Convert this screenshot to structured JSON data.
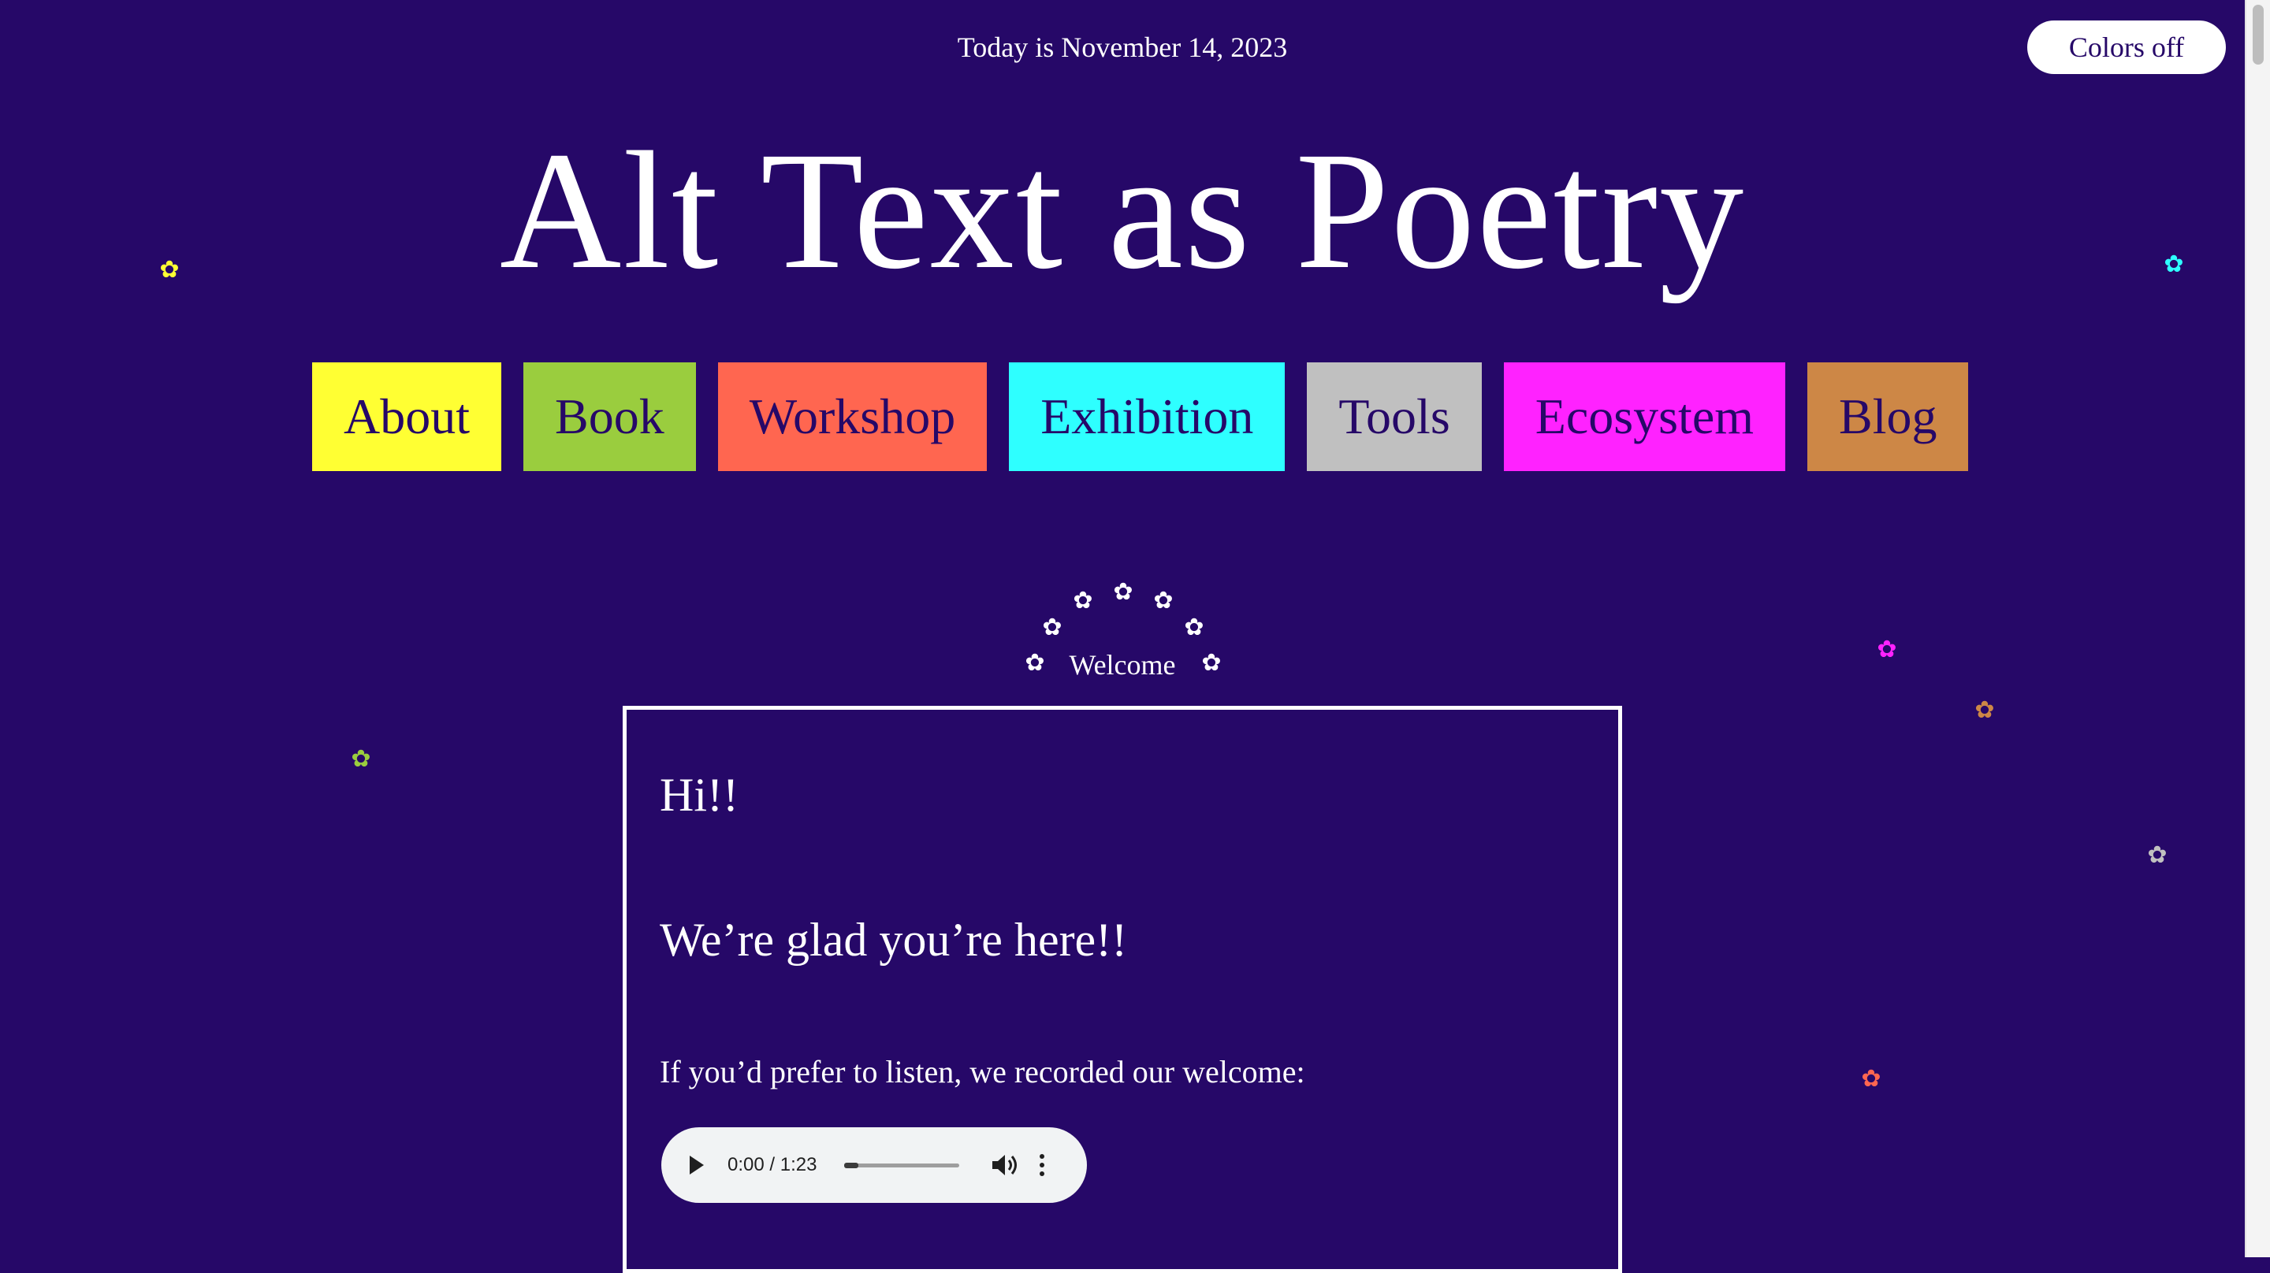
{
  "header": {
    "date_text": "Today is November 14, 2023",
    "colors_button_label": "Colors off"
  },
  "site_title": "Alt Text as Poetry",
  "nav": [
    {
      "label": "About",
      "color": "#ffff33"
    },
    {
      "label": "Book",
      "color": "#9acd3e"
    },
    {
      "label": "Workshop",
      "color": "#ff6650"
    },
    {
      "label": "Exhibition",
      "color": "#2effff"
    },
    {
      "label": "Tools",
      "color": "#c0c0c0"
    },
    {
      "label": "Ecosystem",
      "color": "#ff22ff"
    },
    {
      "label": "Blog",
      "color": "#cd8746"
    }
  ],
  "welcome": {
    "label": "Welcome",
    "greeting": "Hi!!",
    "glad": "We’re glad you’re here!!",
    "listen_prompt": "If you’d prefer to listen, we recorded our welcome:"
  },
  "audio": {
    "time": "0:00 / 1:23",
    "progress": 0.12
  },
  "theme": {
    "background": "#260868",
    "text": "#ffffff",
    "flower_glyph": "✿"
  }
}
